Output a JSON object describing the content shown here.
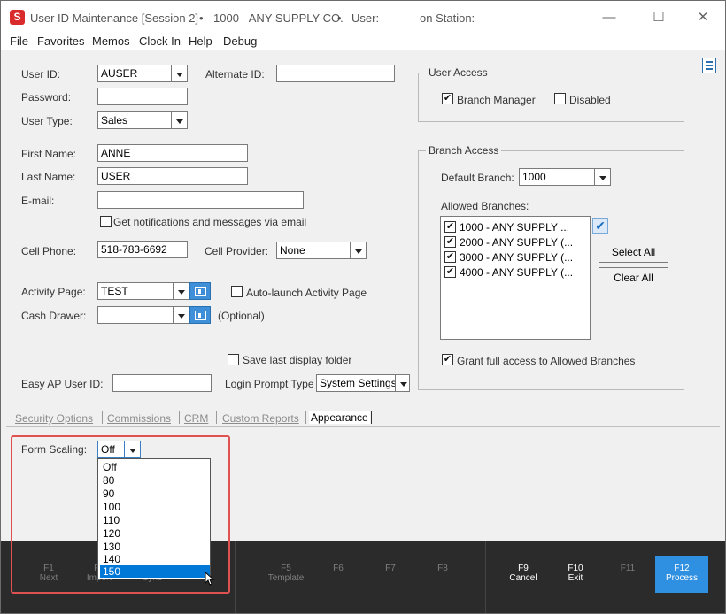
{
  "titlebar": {
    "app_icon": "S",
    "title": "User ID Maintenance [Session 2]",
    "bullet": "•",
    "company": "1000 - ANY SUPPLY CO.",
    "user_label": "User:",
    "station_label": "on Station:"
  },
  "window_controls": {
    "minimize": "—",
    "maximize": "☐",
    "close": "✕"
  },
  "menu": [
    "File",
    "Favorites",
    "Memos",
    "Clock In",
    "Help",
    "Debug"
  ],
  "form": {
    "user_id_label": "User ID:",
    "user_id": "AUSER",
    "alternate_id_label": "Alternate ID:",
    "alternate_id": "",
    "password_label": "Password:",
    "password": "",
    "user_type_label": "User Type:",
    "user_type": "Sales",
    "first_name_label": "First Name:",
    "first_name": "ANNE",
    "last_name_label": "Last Name:",
    "last_name": "USER",
    "email_label": "E-mail:",
    "email": "",
    "notify_label": "Get notifications and messages via email",
    "notify_checked": false,
    "cell_phone_label": "Cell Phone:",
    "cell_phone": "518-783-6692",
    "cell_provider_label": "Cell Provider:",
    "cell_provider": "None",
    "activity_page_label": "Activity Page:",
    "activity_page": "TEST",
    "auto_launch_label": "Auto-launch Activity Page",
    "auto_launch_checked": false,
    "cash_drawer_label": "Cash Drawer:",
    "cash_drawer": "",
    "optional_label": "(Optional)",
    "save_folder_label": "Save last display folder",
    "save_folder_checked": false,
    "easy_ap_label": "Easy AP User ID:",
    "easy_ap": "",
    "login_prompt_label": "Login Prompt Type",
    "login_prompt": "System Settings"
  },
  "user_access": {
    "title": "User Access",
    "branch_manager_label": "Branch Manager",
    "branch_manager_checked": true,
    "disabled_label": "Disabled",
    "disabled_checked": false
  },
  "branch_access": {
    "title": "Branch Access",
    "default_branch_label": "Default Branch:",
    "default_branch": "1000",
    "allowed_label": "Allowed Branches:",
    "branches": [
      {
        "label": "1000 - ANY SUPPLY ...",
        "checked": true
      },
      {
        "label": "2000 - ANY SUPPLY (...",
        "checked": true
      },
      {
        "label": "3000 - ANY SUPPLY (...",
        "checked": true
      },
      {
        "label": "4000 - ANY SUPPLY (...",
        "checked": true
      }
    ],
    "select_all": "Select All",
    "clear_all": "Clear All",
    "grant_label": "Grant full access to Allowed Branches",
    "grant_checked": true
  },
  "tabs": [
    "Security Options",
    "Commissions",
    "CRM",
    "Custom Reports",
    "Appearance"
  ],
  "appearance": {
    "form_scaling_label": "Form Scaling:",
    "form_scaling": "Off",
    "options": [
      "Off",
      "80",
      "90",
      "100",
      "110",
      "120",
      "130",
      "140",
      "150"
    ],
    "highlighted_option": "150"
  },
  "function_keys": [
    {
      "key": "F1",
      "label": "Next"
    },
    {
      "key": "F2",
      "label": "Import"
    },
    {
      "key": "F3",
      "label": "Sync"
    },
    {
      "key": "F5",
      "label": "Template"
    },
    {
      "key": "F6",
      "label": ""
    },
    {
      "key": "F7",
      "label": ""
    },
    {
      "key": "F8",
      "label": ""
    },
    {
      "key": "F9",
      "label": "Cancel"
    },
    {
      "key": "F10",
      "label": "Exit"
    },
    {
      "key": "F11",
      "label": ""
    },
    {
      "key": "F12",
      "label": "Process"
    }
  ],
  "colors": {
    "accent": "#0078d7",
    "fkey_active": "#2f8fe0",
    "app_icon": "#d92b2b",
    "highlight_border": "#e05252"
  }
}
